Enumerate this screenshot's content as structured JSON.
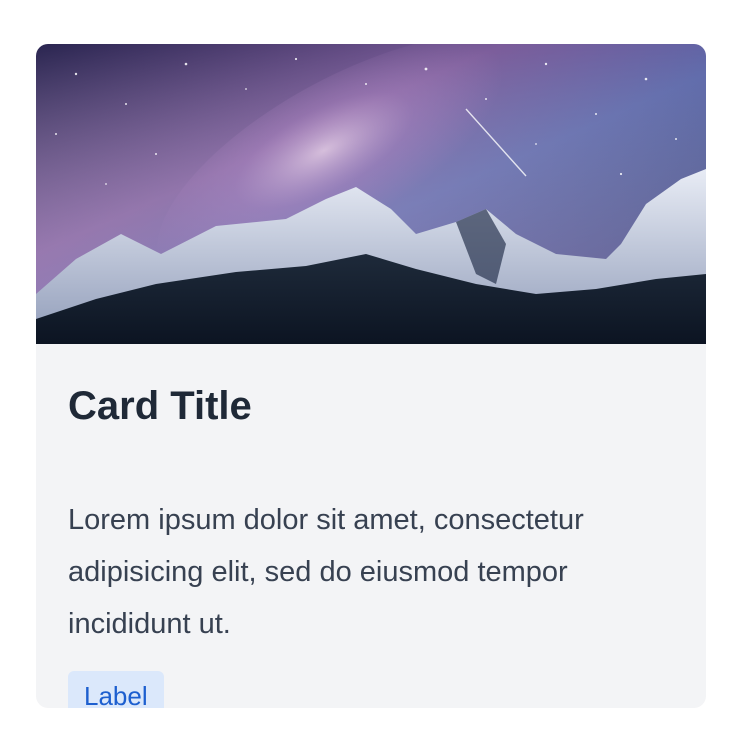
{
  "card": {
    "image_description": "night mountain landscape with starry sky",
    "title": "Card Title",
    "text": "Lorem ipsum dolor sit amet, consectetur adipisicing elit, sed do eiusmod tempor incididunt ut.",
    "label": "Label"
  },
  "colors": {
    "card_background": "#f3f4f6",
    "title": "#1f2937",
    "text": "#374151",
    "label_background": "#dbe8fb",
    "label_text": "#1d5fcf"
  }
}
